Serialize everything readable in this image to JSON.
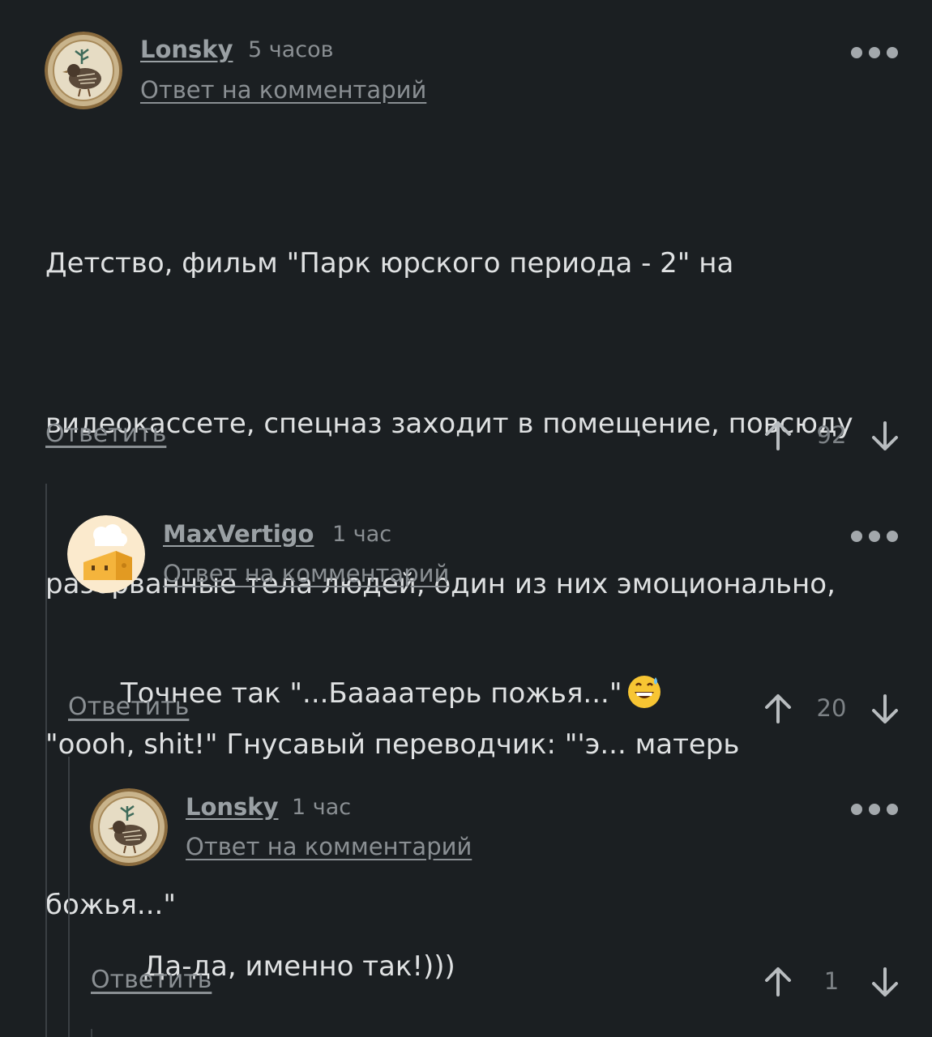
{
  "comments": [
    {
      "username": "Lonsky",
      "time": "5 часов",
      "reply_to": "Ответ на комментарий",
      "text": "Детство, фильм \"Парк юрского периода - 2\" на видеокассете, спецназ заходит в помещение, повсюду разорванные тела людей, один из них эмоционально, \"oooh, shit!\" Гнусавый переводчик: \"'э... матерь божья...\"",
      "text_lines": [
        "Детство, фильм \"Парк юрского периода - 2\" на",
        "видеокассете, спецназ заходит в помещение, повсюду",
        "разорванные тела людей, один из них эмоционально,",
        "\"oooh, shit!\" Гнусавый переводчик: \"'э... матерь",
        "божья...\""
      ],
      "answer_label": "Ответить",
      "rating": "92",
      "avatar_icon": "quail-mosaic-avatar"
    },
    {
      "username": "MaxVertigo",
      "time": "1 час",
      "reply_to": "Ответ на комментарий",
      "text": "Точнее так \"...Баааатерь пожья...\"",
      "emoji": "grinning-sweat-emoji",
      "answer_label": "Ответить",
      "rating": "20",
      "avatar_icon": "chef-cheese-avatar"
    },
    {
      "username": "Lonsky",
      "time": "1 час",
      "reply_to": "Ответ на комментарий",
      "text": "Да-да, именно так!)))",
      "answer_label": "Ответить",
      "rating": "1",
      "avatar_icon": "quail-mosaic-avatar"
    }
  ],
  "colors": {
    "background": "#1b1f22",
    "text": "#dfe1e2",
    "muted": "#8a8f93",
    "thread_line": "#3a3f43"
  }
}
